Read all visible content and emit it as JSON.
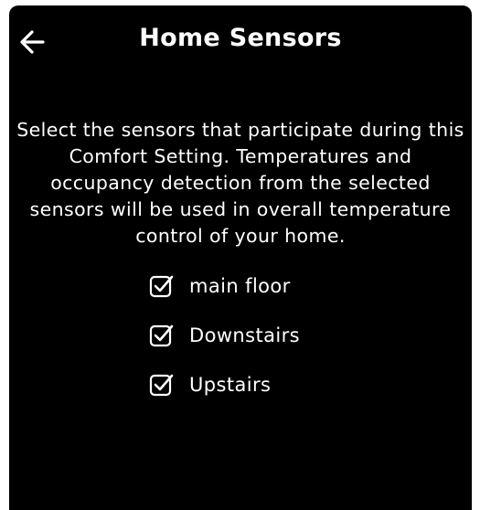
{
  "header": {
    "title": "Home Sensors",
    "back_icon": "arrow-left-icon"
  },
  "description": "Select the sensors that participate during this Comfort Setting. Temperatures and occupancy detection from the selected sensors will be used in overall temperature control of your home.",
  "sensors": [
    {
      "label": "main floor",
      "checked": true
    },
    {
      "label": "Downstairs",
      "checked": true
    },
    {
      "label": "Upstairs",
      "checked": true
    }
  ],
  "colors": {
    "background": "#000000",
    "text": "#ffffff"
  }
}
